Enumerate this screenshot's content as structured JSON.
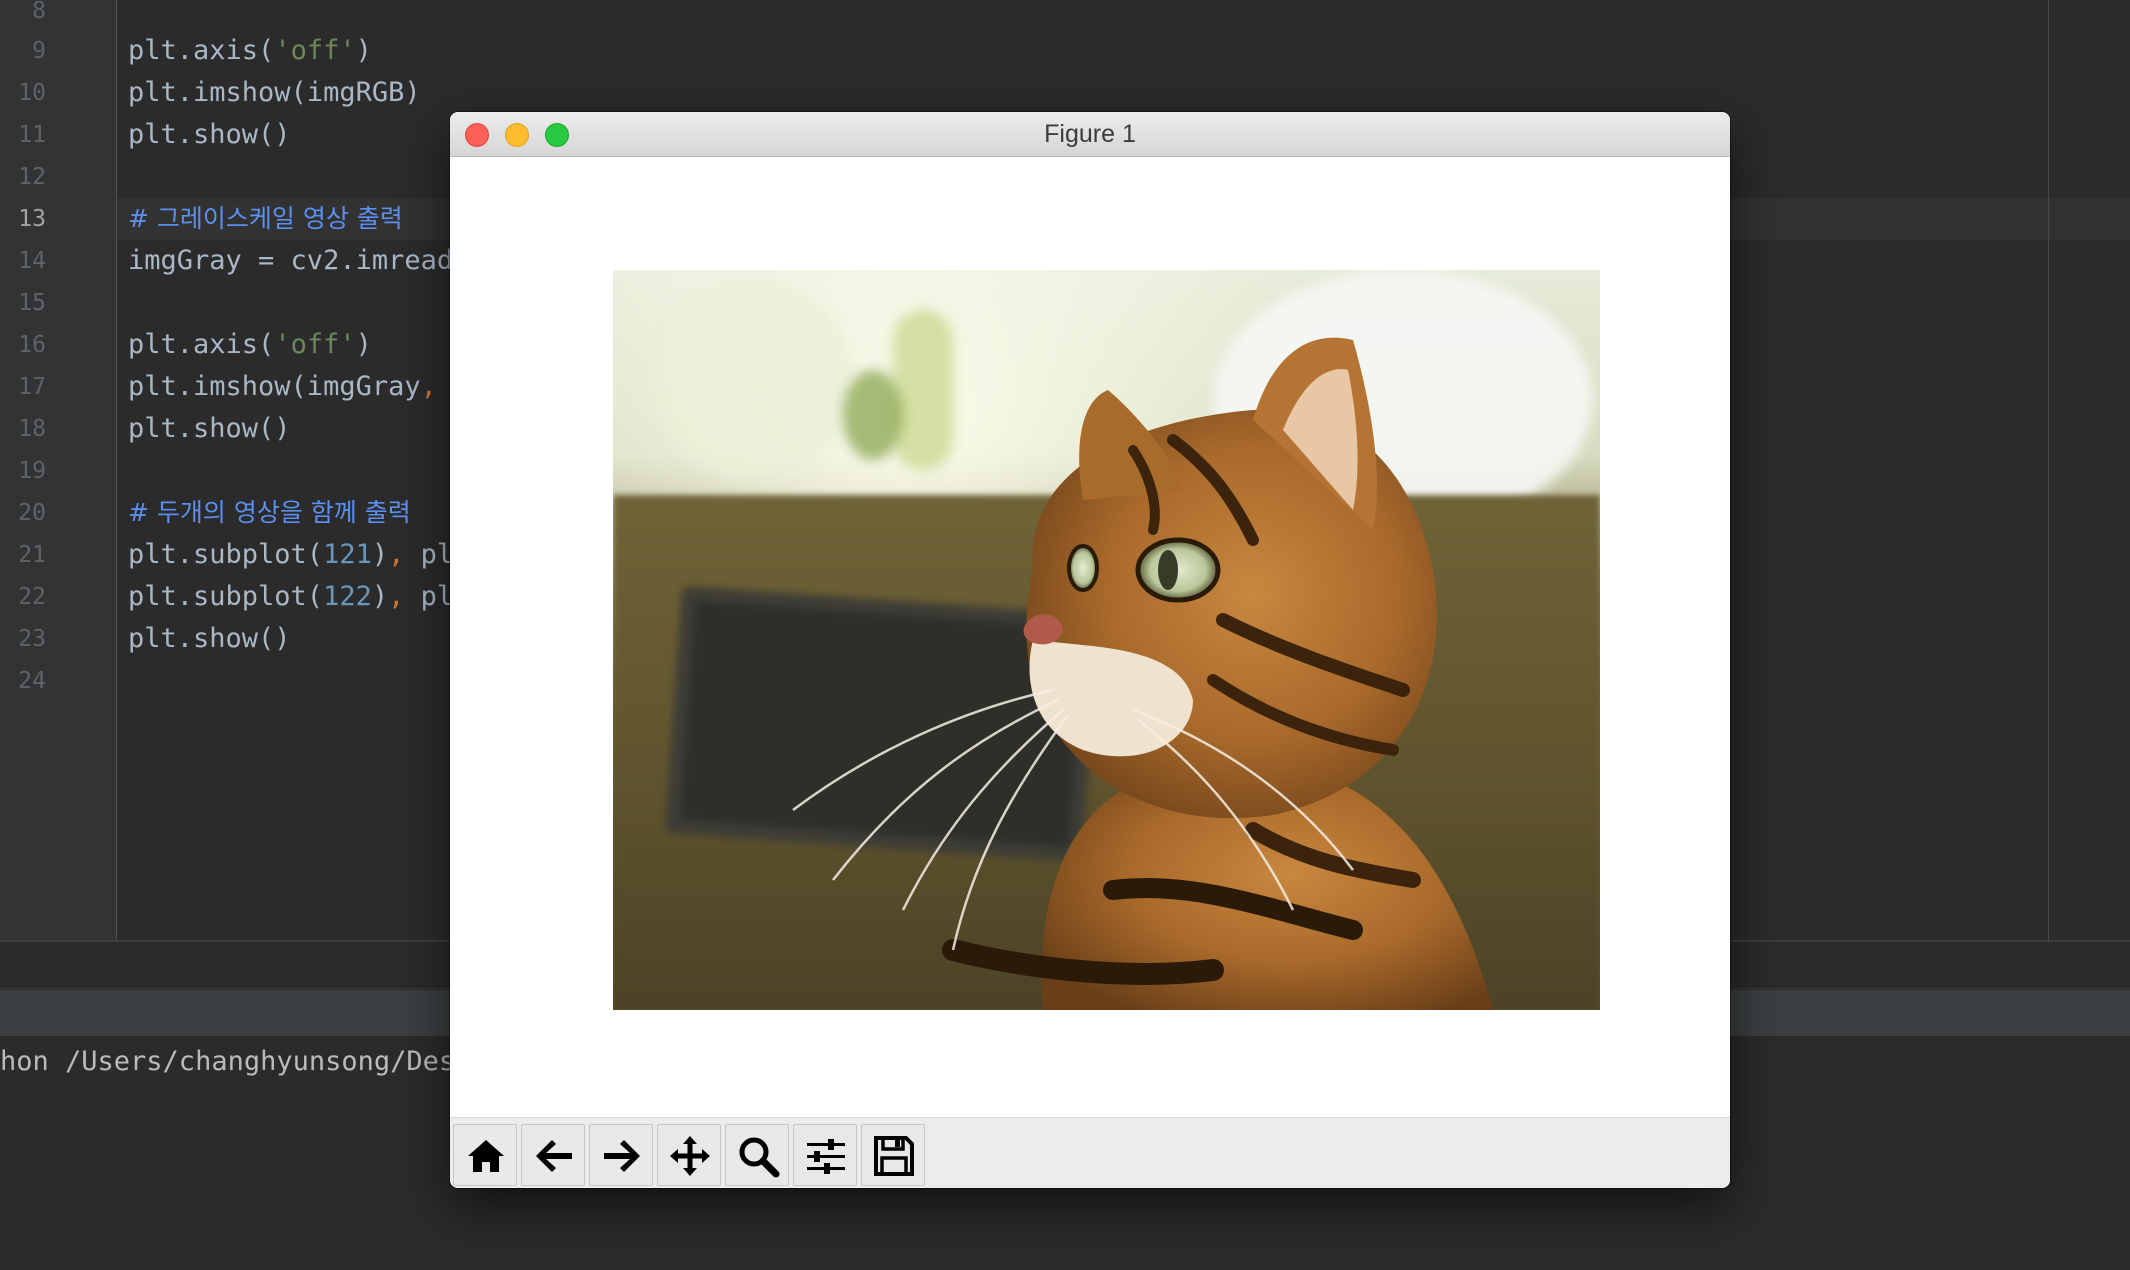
{
  "editor": {
    "line_numbers": [
      "8",
      "9",
      "10",
      "11",
      "12",
      "13",
      "14",
      "15",
      "16",
      "17",
      "18",
      "19",
      "20",
      "21",
      "22",
      "23",
      "24"
    ],
    "active_line": "13",
    "code_lines": [
      {
        "line": "9",
        "text": "plt.axis('off')",
        "kind": "code"
      },
      {
        "line": "10",
        "text": "plt.imshow(imgRGB)",
        "kind": "code"
      },
      {
        "line": "11",
        "text": "plt.show()",
        "kind": "code"
      },
      {
        "line": "13",
        "text": "# 그레이스케일 영상 출력",
        "kind": "comment"
      },
      {
        "line": "14",
        "text": "imgGray = cv2.imread",
        "kind": "code"
      },
      {
        "line": "16",
        "text": "plt.axis('off')",
        "kind": "code"
      },
      {
        "line": "17",
        "text": "plt.imshow(imgGray,",
        "kind": "code"
      },
      {
        "line": "18",
        "text": "plt.show()",
        "kind": "code"
      },
      {
        "line": "20",
        "text": "# 두개의 영상을 함께 출력",
        "kind": "comment"
      },
      {
        "line": "21",
        "text": "plt.subplot(121), pl",
        "kind": "code"
      },
      {
        "line": "22",
        "text": "plt.subplot(122), pl",
        "kind": "code"
      },
      {
        "line": "23",
        "text": "plt.show()",
        "kind": "code"
      }
    ]
  },
  "run_panel": {
    "output_line": "hon /Users/changhyunsong/Desk"
  },
  "figure_window": {
    "title": "Figure 1",
    "image_alt": "cat-photo",
    "toolbar": [
      {
        "icon": "home-icon"
      },
      {
        "icon": "back-arrow-icon"
      },
      {
        "icon": "forward-arrow-icon"
      },
      {
        "icon": "pan-move-icon"
      },
      {
        "icon": "zoom-magnifier-icon"
      },
      {
        "icon": "configure-subplots-icon"
      },
      {
        "icon": "save-floppy-icon"
      }
    ]
  },
  "colors": {
    "editor_bg": "#2b2b2b",
    "gutter_bg": "#313335",
    "code_text": "#a9b7c6",
    "comment": "#5b8ff0",
    "string": "#6a8759",
    "number": "#6897bb",
    "comma": "#cc7832",
    "close": "#fe5f57",
    "minimize": "#febc2e",
    "maximize": "#28c840"
  }
}
